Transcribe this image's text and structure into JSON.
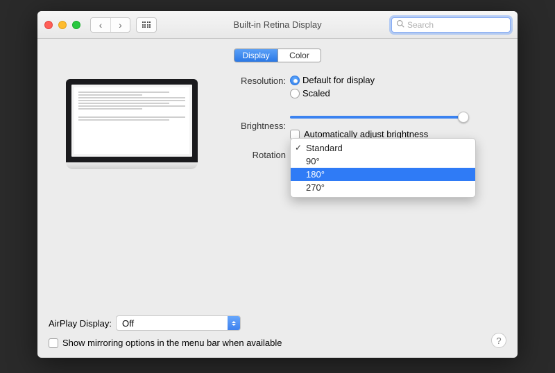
{
  "window": {
    "title": "Built-in Retina Display"
  },
  "search": {
    "placeholder": "Search"
  },
  "tabs": {
    "display": "Display",
    "color": "Color"
  },
  "resolution": {
    "label": "Resolution:",
    "option_default": "Default for display",
    "option_scaled": "Scaled",
    "selected": "default"
  },
  "brightness": {
    "label": "Brightness:",
    "value_pct": 97,
    "auto_label": "Automatically adjust brightness",
    "auto_checked": false
  },
  "rotation": {
    "label": "Rotation",
    "options": [
      "Standard",
      "90°",
      "180°",
      "270°"
    ],
    "current": "Standard",
    "highlighted": "180°"
  },
  "airplay": {
    "label": "AirPlay Display:",
    "value": "Off"
  },
  "mirroring": {
    "label": "Show mirroring options in the menu bar when available",
    "checked": false
  }
}
